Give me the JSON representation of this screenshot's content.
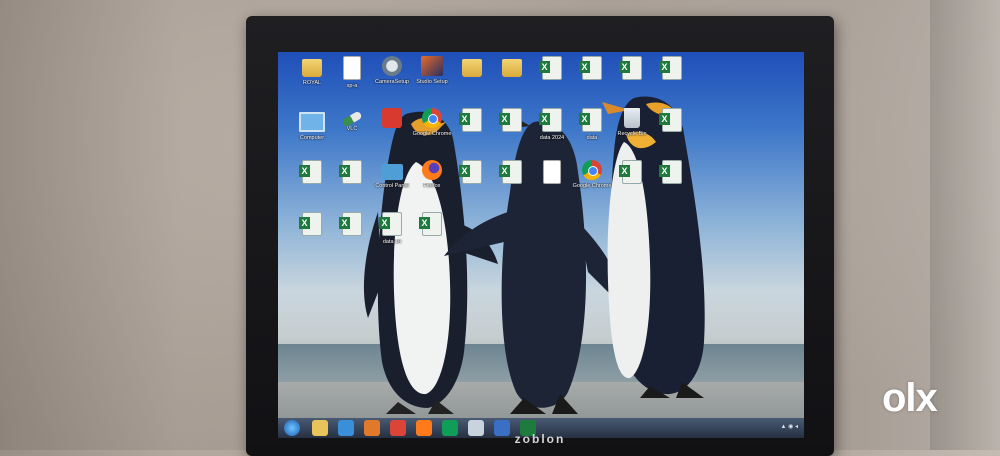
{
  "photo": {
    "subject": "monitor-on-wall"
  },
  "monitor": {
    "brand": "zoblon"
  },
  "watermark": {
    "text": "olx"
  },
  "desktop": {
    "wallpaper": "penguins",
    "icons": [
      {
        "label": "ROYAL",
        "icon": "folder-icon",
        "kind": "folder"
      },
      {
        "label": "sp-a",
        "icon": "document-icon",
        "kind": "doc"
      },
      {
        "label": "CameraSetup",
        "icon": "setup-icon",
        "kind": "setup"
      },
      {
        "label": "Studio Setup",
        "icon": "image-icon",
        "kind": "img"
      },
      {
        "label": "",
        "icon": "folder-icon",
        "kind": "folder"
      },
      {
        "label": "",
        "icon": "folder-icon",
        "kind": "folder"
      },
      {
        "label": "",
        "icon": "excel-icon",
        "kind": "excel"
      },
      {
        "label": "",
        "icon": "excel-icon",
        "kind": "excel"
      },
      {
        "label": "",
        "icon": "excel-icon",
        "kind": "excel"
      },
      {
        "label": "",
        "icon": "excel-icon",
        "kind": "excel"
      },
      {
        "label": "Computer",
        "icon": "computer-icon",
        "kind": "pc"
      },
      {
        "label": "VLC",
        "icon": "pill-icon",
        "kind": "pill"
      },
      {
        "label": "",
        "icon": "app-icon",
        "kind": "app"
      },
      {
        "label": "Google Chrome",
        "icon": "chrome-icon",
        "kind": "chrome"
      },
      {
        "label": "",
        "icon": "excel-icon",
        "kind": "excel"
      },
      {
        "label": "",
        "icon": "excel-icon",
        "kind": "excel"
      },
      {
        "label": "data 2024",
        "icon": "excel-icon",
        "kind": "excel"
      },
      {
        "label": "data",
        "icon": "excel-icon",
        "kind": "excel"
      },
      {
        "label": "Recycle Bin",
        "icon": "recycle-bin-icon",
        "kind": "recycle"
      },
      {
        "label": "",
        "icon": "excel-icon",
        "kind": "excel"
      },
      {
        "label": "",
        "icon": "excel-icon",
        "kind": "excel"
      },
      {
        "label": "",
        "icon": "excel-icon",
        "kind": "excel"
      },
      {
        "label": "Control Panel",
        "icon": "control-panel-icon",
        "kind": "panel"
      },
      {
        "label": "Firefox",
        "icon": "firefox-icon",
        "kind": "firefox"
      },
      {
        "label": "",
        "icon": "excel-icon",
        "kind": "excel"
      },
      {
        "label": "",
        "icon": "excel-icon",
        "kind": "excel"
      },
      {
        "label": "",
        "icon": "doc-icon",
        "kind": "doc"
      },
      {
        "label": "Google Chrome",
        "icon": "chrome-icon",
        "kind": "chrome"
      },
      {
        "label": "",
        "icon": "excel-icon",
        "kind": "excel"
      },
      {
        "label": "",
        "icon": "excel-icon",
        "kind": "excel"
      },
      {
        "label": "",
        "icon": "excel-icon",
        "kind": "excel"
      },
      {
        "label": "",
        "icon": "excel-icon",
        "kind": "excel"
      },
      {
        "label": "data 14",
        "icon": "excel-icon",
        "kind": "excel"
      },
      {
        "label": "",
        "icon": "excel-icon",
        "kind": "excel"
      }
    ],
    "taskbar": {
      "items": [
        {
          "icon": "explorer-icon",
          "color": "#e8c45a"
        },
        {
          "icon": "ie-icon",
          "color": "#3a8fd9"
        },
        {
          "icon": "media-icon",
          "color": "#e07a2a"
        },
        {
          "icon": "chrome-icon",
          "color": "#db4437"
        },
        {
          "icon": "firefox-icon",
          "color": "#ff7a1a"
        },
        {
          "icon": "chrome-icon",
          "color": "#0f9d58"
        },
        {
          "icon": "app-icon",
          "color": "#c9d3dd"
        },
        {
          "icon": "app-icon",
          "color": "#3b6fc4"
        },
        {
          "icon": "excel-icon",
          "color": "#1f7a3e"
        }
      ]
    }
  }
}
